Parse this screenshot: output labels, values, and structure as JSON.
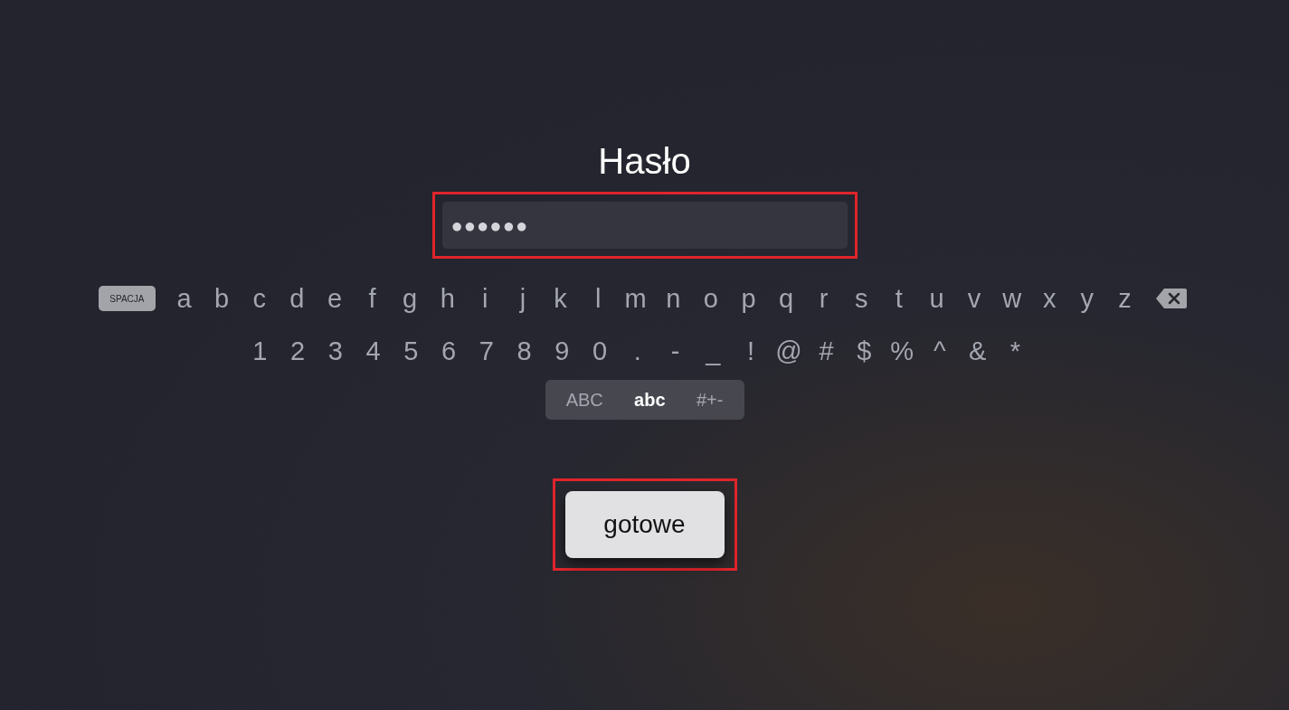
{
  "title": "Hasło",
  "password_field": {
    "value": "●●●●●●",
    "highlighted": true
  },
  "keyboard_rows": [
    [
      {
        "kind": "space",
        "label": "SPACJA"
      },
      {
        "kind": "char",
        "label": "a"
      },
      {
        "kind": "char",
        "label": "b"
      },
      {
        "kind": "char",
        "label": "c"
      },
      {
        "kind": "char",
        "label": "d"
      },
      {
        "kind": "char",
        "label": "e"
      },
      {
        "kind": "char",
        "label": "f"
      },
      {
        "kind": "char",
        "label": "g"
      },
      {
        "kind": "char",
        "label": "h"
      },
      {
        "kind": "char",
        "label": "i"
      },
      {
        "kind": "char",
        "label": "j"
      },
      {
        "kind": "char",
        "label": "k"
      },
      {
        "kind": "char",
        "label": "l"
      },
      {
        "kind": "char",
        "label": "m"
      },
      {
        "kind": "char",
        "label": "n"
      },
      {
        "kind": "char",
        "label": "o"
      },
      {
        "kind": "char",
        "label": "p"
      },
      {
        "kind": "char",
        "label": "q"
      },
      {
        "kind": "char",
        "label": "r"
      },
      {
        "kind": "char",
        "label": "s"
      },
      {
        "kind": "char",
        "label": "t"
      },
      {
        "kind": "char",
        "label": "u"
      },
      {
        "kind": "char",
        "label": "v"
      },
      {
        "kind": "char",
        "label": "w"
      },
      {
        "kind": "char",
        "label": "x"
      },
      {
        "kind": "char",
        "label": "y"
      },
      {
        "kind": "char",
        "label": "z"
      },
      {
        "kind": "backspace"
      }
    ],
    [
      {
        "kind": "char",
        "label": "1"
      },
      {
        "kind": "char",
        "label": "2"
      },
      {
        "kind": "char",
        "label": "3"
      },
      {
        "kind": "char",
        "label": "4"
      },
      {
        "kind": "char",
        "label": "5"
      },
      {
        "kind": "char",
        "label": "6"
      },
      {
        "kind": "char",
        "label": "7"
      },
      {
        "kind": "char",
        "label": "8"
      },
      {
        "kind": "char",
        "label": "9"
      },
      {
        "kind": "char",
        "label": "0"
      },
      {
        "kind": "char",
        "label": "."
      },
      {
        "kind": "char",
        "label": "-"
      },
      {
        "kind": "char",
        "label": "_"
      },
      {
        "kind": "char",
        "label": "!"
      },
      {
        "kind": "char",
        "label": "@"
      },
      {
        "kind": "char",
        "label": "#"
      },
      {
        "kind": "char",
        "label": "$"
      },
      {
        "kind": "char",
        "label": "%"
      },
      {
        "kind": "char",
        "label": "^"
      },
      {
        "kind": "char",
        "label": "&"
      },
      {
        "kind": "char",
        "label": "*"
      }
    ]
  ],
  "modes": [
    {
      "label": "ABC",
      "selected": false
    },
    {
      "label": "abc",
      "selected": true
    },
    {
      "label": "#+-",
      "selected": false
    }
  ],
  "done_button": {
    "label": "gotowe",
    "highlighted": true
  }
}
